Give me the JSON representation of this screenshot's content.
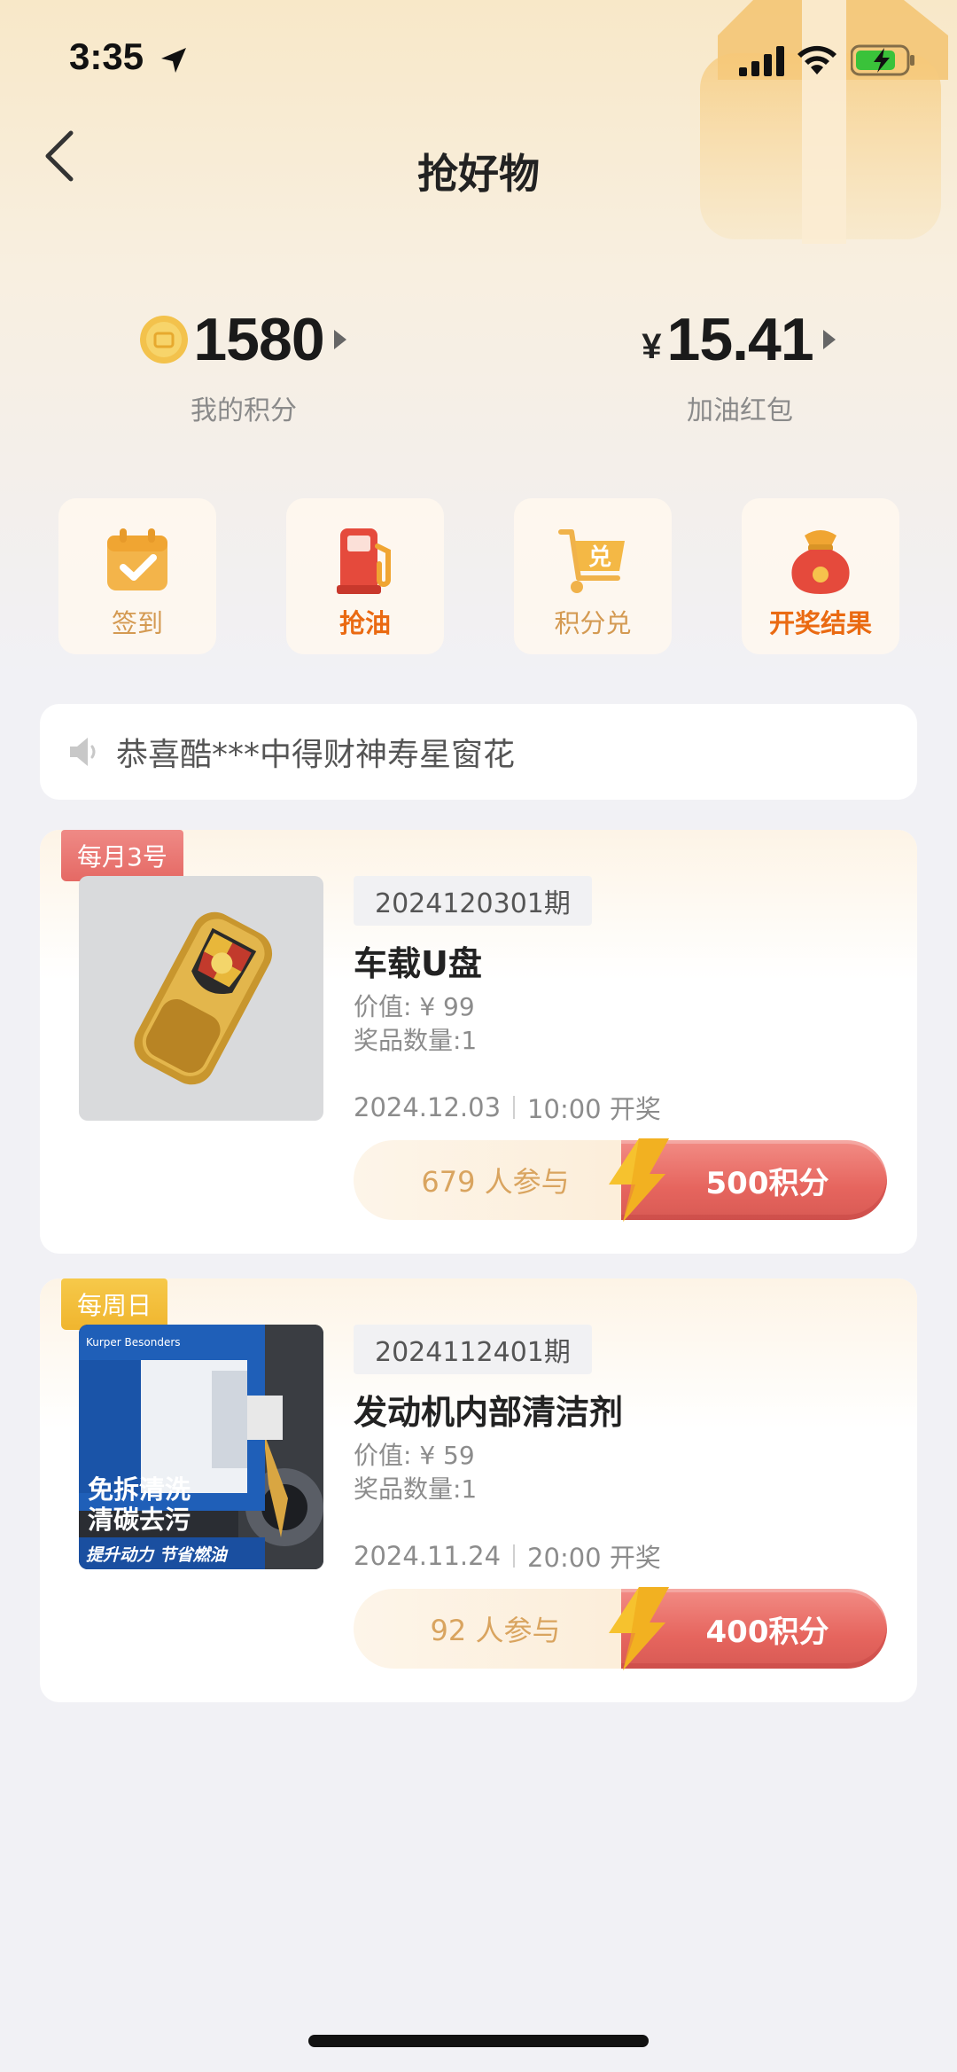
{
  "status_bar": {
    "time": "3:35"
  },
  "header": {
    "title": "抢好物"
  },
  "stats": {
    "points": {
      "value": "1580",
      "label": "我的积分"
    },
    "cash": {
      "currency": "¥",
      "value": "15.41",
      "label": "加油红包"
    }
  },
  "quick_actions": [
    {
      "label": "签到",
      "icon": "calendar-check-icon"
    },
    {
      "label": "抢油",
      "icon": "fuel-pump-icon"
    },
    {
      "label": "积分兑",
      "icon": "exchange-cart-icon"
    },
    {
      "label": "开奖结果",
      "icon": "lucky-bag-icon"
    }
  ],
  "notice": {
    "text": "恭喜酷***中得财神寿星窗花"
  },
  "prizes": [
    {
      "badge": "每月3号",
      "issue": "2024120301期",
      "name": "车载U盘",
      "value": "价值: ¥ 99",
      "quantity": "奖品数量:1",
      "date": "2024.12.03",
      "time": "10:00 开奖",
      "participants": "679 人参与",
      "cost": "500积分"
    },
    {
      "badge": "每周日",
      "issue": "2024112401期",
      "name": "发动机内部清洁剂",
      "value": "价值: ¥ 59",
      "quantity": "奖品数量:1",
      "date": "2024.11.24",
      "time": "20:00 开奖",
      "participants": "92 人参与",
      "cost": "400积分",
      "image_text": {
        "brand": "Kurper Besonders",
        "line1": "免拆清洗",
        "line2": "清碳去污",
        "line3": "提升动力 节省燃油"
      }
    }
  ],
  "colors": {
    "accent_orange": "#ea6a12",
    "button_red": "#e6655e",
    "badge_red": "#e56964",
    "badge_yellow": "#f0b52e"
  }
}
